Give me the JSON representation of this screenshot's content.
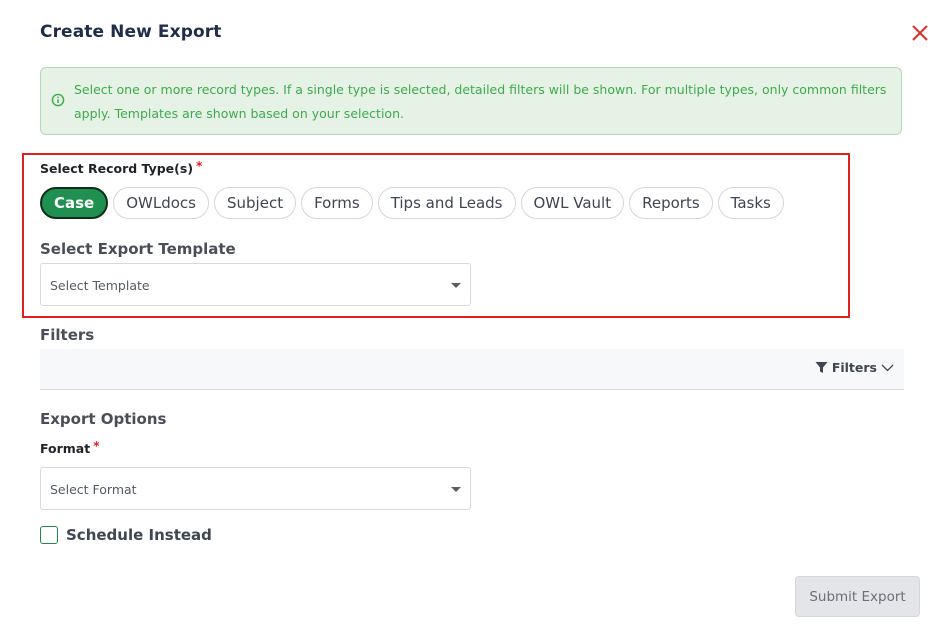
{
  "dialog": {
    "title": "Create New Export",
    "close_icon": "close-icon"
  },
  "info": {
    "icon": "info-icon",
    "text": "Select one or more record types. If a single type is selected, detailed filters will be shown. For multiple types, only common filters apply. Templates are shown based on your selection."
  },
  "record_types": {
    "label": "Select Record Type(s)",
    "required_mark": "*",
    "chips": [
      {
        "label": "Case",
        "selected": true
      },
      {
        "label": "OWLdocs",
        "selected": false
      },
      {
        "label": "Subject",
        "selected": false
      },
      {
        "label": "Forms",
        "selected": false
      },
      {
        "label": "Tips and Leads",
        "selected": false
      },
      {
        "label": "OWL Vault",
        "selected": false
      },
      {
        "label": "Reports",
        "selected": false
      },
      {
        "label": "Tasks",
        "selected": false
      }
    ]
  },
  "template": {
    "label": "Select Export Template",
    "placeholder": "Select Template"
  },
  "filters": {
    "label": "Filters",
    "button_label": "Filters",
    "icon": "filter-icon"
  },
  "export_options": {
    "label": "Export Options",
    "format_label": "Format",
    "required_mark": "*",
    "format_placeholder": "Select Format"
  },
  "schedule": {
    "label": "Schedule Instead",
    "checked": false
  },
  "submit": {
    "label": "Submit Export",
    "enabled": false
  },
  "colors": {
    "accent_green": "#1f9050",
    "highlight_red": "#e02020",
    "info_bg": "#e6f2e6",
    "info_text": "#3eaa4e"
  }
}
